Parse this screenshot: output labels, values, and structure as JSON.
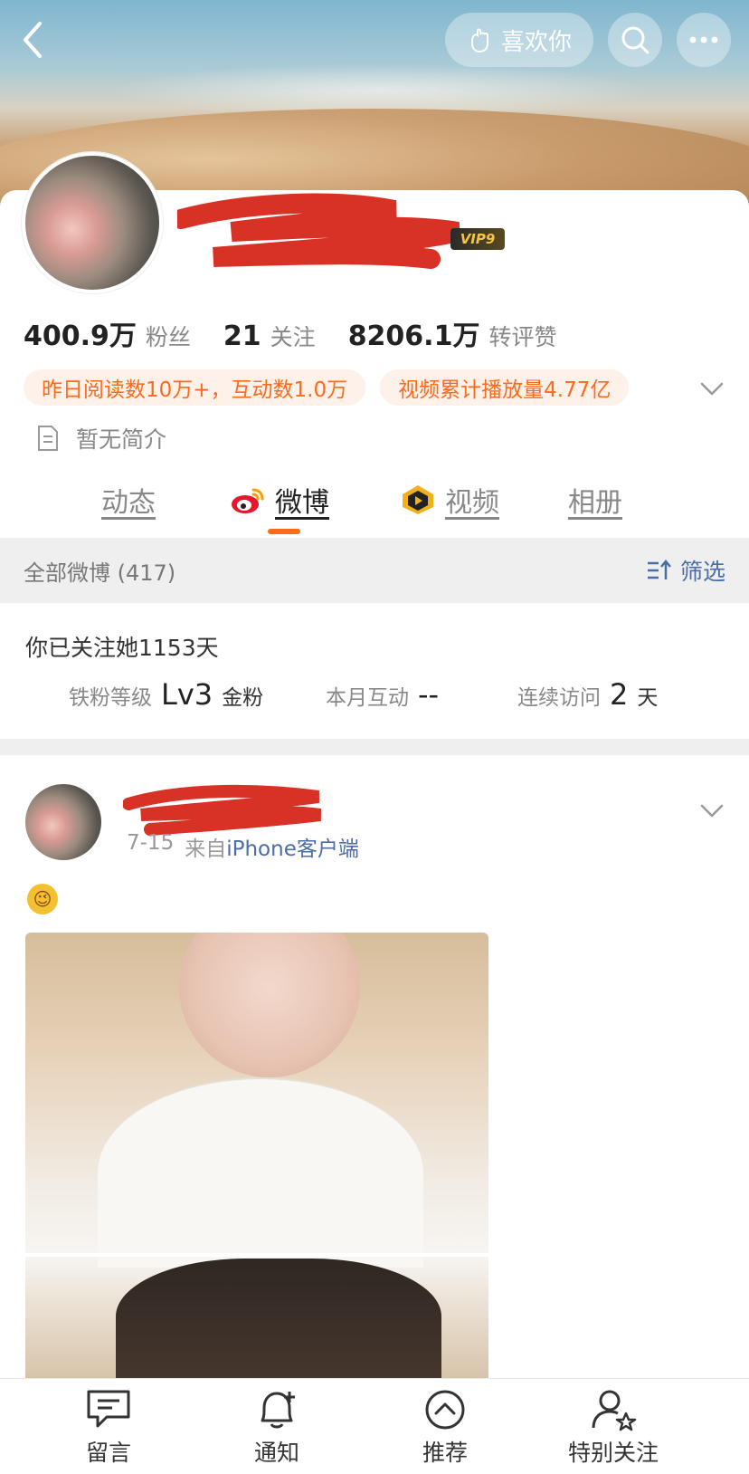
{
  "header": {
    "like_label": "喜欢你",
    "icons": {
      "back": "back-arrow-icon",
      "like": "hand-like-icon",
      "search": "search-icon",
      "more": "more-icon"
    }
  },
  "profile": {
    "vip_badge": "VIP9",
    "stats": [
      {
        "num": "400.9万",
        "label": "粉丝"
      },
      {
        "num": "21",
        "label": "关注"
      },
      {
        "num": "8206.1万",
        "label": "转评赞"
      }
    ],
    "tags": [
      "昨日阅读数10万+，互动数1.0万",
      "视频累计播放量4.77亿"
    ],
    "bio": "暂无简介"
  },
  "tabs": [
    {
      "label": "动态",
      "icon": null
    },
    {
      "label": "微博",
      "icon": "weibo-icon",
      "active": true
    },
    {
      "label": "视频",
      "icon": "video-icon"
    },
    {
      "label": "相册",
      "icon": null
    }
  ],
  "filter": {
    "title": "全部微博 (417)",
    "button": "筛选"
  },
  "fan": {
    "follow_days": "你已关注她1153天",
    "items": [
      {
        "label": "铁粉等级",
        "value": "Lv3",
        "unit": "金粉"
      },
      {
        "label": "本月互动",
        "value": "--",
        "unit": ""
      },
      {
        "label": "连续访问",
        "value": "2",
        "unit": "天"
      }
    ]
  },
  "post": {
    "date": "7-15",
    "from": "来自",
    "source": "iPhone客户端",
    "emoji": "😉"
  },
  "bottom_bar": [
    {
      "label": "留言",
      "icon": "message-icon"
    },
    {
      "label": "通知",
      "icon": "bell-plus-icon"
    },
    {
      "label": "推荐",
      "icon": "recommend-up-icon"
    },
    {
      "label": "特别关注",
      "icon": "special-follow-icon"
    }
  ],
  "colors": {
    "accent": "#ff6a1a",
    "link": "#4a6da8",
    "tag_bg": "#fdf1ea"
  }
}
